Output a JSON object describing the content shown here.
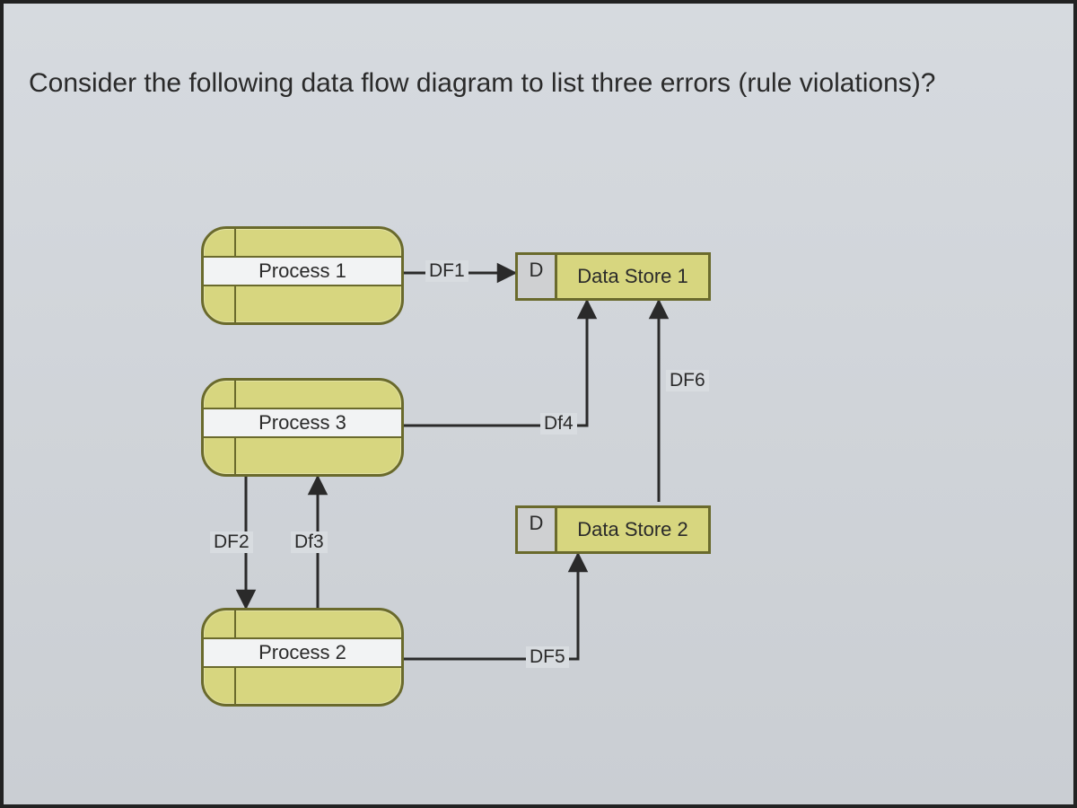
{
  "question": "Consider the following data flow diagram to list three errors (rule violations)?",
  "processes": {
    "p1": "Process 1",
    "p2": "Process 2",
    "p3": "Process 3"
  },
  "datastores": {
    "d1": {
      "stub": "D",
      "label": "Data Store 1"
    },
    "d2": {
      "stub": "D",
      "label": "Data Store 2"
    }
  },
  "flows": {
    "df1": "DF1",
    "df2": "DF2",
    "df3": "Df3",
    "df4": "Df4",
    "df5": "DF5",
    "df6": "DF6"
  }
}
